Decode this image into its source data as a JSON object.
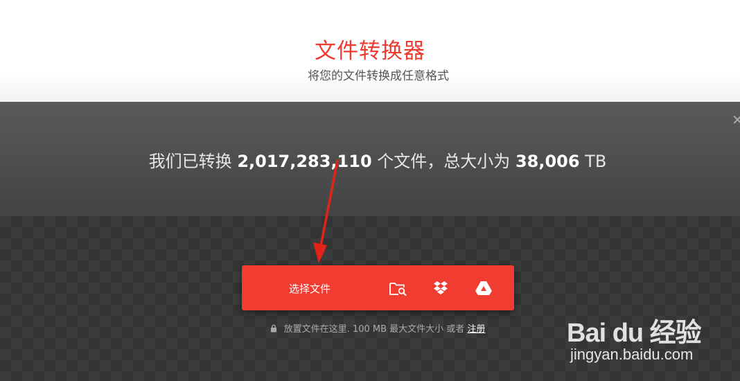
{
  "header": {
    "title": "文件转换器",
    "subtitle": "将您的文件转换成任意格式"
  },
  "stats": {
    "prefix": "我们已转换",
    "file_count": "2,017,283,110",
    "middle": "个文件，总大小为",
    "total_size": "38,006",
    "unit": "TB"
  },
  "close_icon": "close-icon",
  "upload": {
    "choose_label": "选择文件",
    "icons": [
      "folder-search-icon",
      "dropbox-icon",
      "google-drive-icon"
    ]
  },
  "note": {
    "text": "放置文件在这里. 100 MB 最大文件大小 或者",
    "register_link": "注册"
  },
  "watermark": {
    "logo_text": "Bai du 经验",
    "url": "jingyan.baidu.com"
  },
  "colors": {
    "accent": "#f13c31",
    "title": "#ee3a2f",
    "panel": "#3d3d3d"
  }
}
